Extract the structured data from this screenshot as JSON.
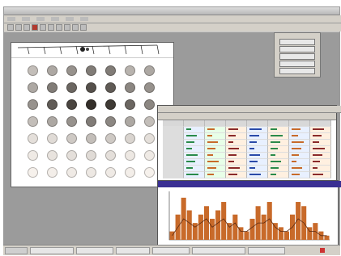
{
  "colors": {
    "titlebar": "#c4c4c4",
    "workspace": "#9b9b9b",
    "plot_title_bg": "#3a2f93",
    "plot_bars": "#c86a2a",
    "plot_line": "#5a2a12"
  },
  "menubar": {
    "items": [
      "",
      "",
      "",
      "",
      "",
      ""
    ]
  },
  "panel": {
    "buttons": [
      "",
      "",
      "",
      "",
      ""
    ]
  },
  "table": {
    "menu_items": [
      "",
      "",
      "",
      "",
      ""
    ],
    "rows": 9,
    "cols": 8
  },
  "plot": {
    "title": ""
  },
  "statusbar": {
    "items": [
      "",
      "",
      "",
      "",
      "",
      "",
      ""
    ]
  },
  "plate": {
    "rows": 7,
    "cols": 7,
    "intensities": [
      [
        0.25,
        0.35,
        0.45,
        0.55,
        0.55,
        0.3,
        0.35
      ],
      [
        0.35,
        0.55,
        0.65,
        0.75,
        0.7,
        0.5,
        0.45
      ],
      [
        0.45,
        0.7,
        0.8,
        0.9,
        0.85,
        0.65,
        0.5
      ],
      [
        0.25,
        0.35,
        0.45,
        0.55,
        0.5,
        0.35,
        0.25
      ],
      [
        0.1,
        0.12,
        0.2,
        0.25,
        0.2,
        0.15,
        0.1
      ],
      [
        0.05,
        0.08,
        0.1,
        0.12,
        0.1,
        0.06,
        0.05
      ],
      [
        0.02,
        0.03,
        0.05,
        0.06,
        0.05,
        0.03,
        0.02
      ]
    ]
  },
  "chart_data": {
    "type": "bar",
    "series": [
      {
        "values": [
          2,
          6,
          10,
          7,
          4,
          6,
          8,
          5,
          7,
          9,
          4,
          6,
          3,
          2,
          5,
          8,
          6,
          9,
          4,
          3,
          2,
          6,
          9,
          8,
          3,
          4,
          2,
          1
        ]
      }
    ],
    "line": {
      "values": [
        1,
        3,
        5,
        4,
        3,
        4,
        5,
        3,
        4,
        5,
        3,
        4,
        2,
        2,
        3,
        4,
        4,
        5,
        3,
        2,
        2,
        3,
        5,
        4,
        2,
        2,
        1,
        1
      ]
    }
  }
}
